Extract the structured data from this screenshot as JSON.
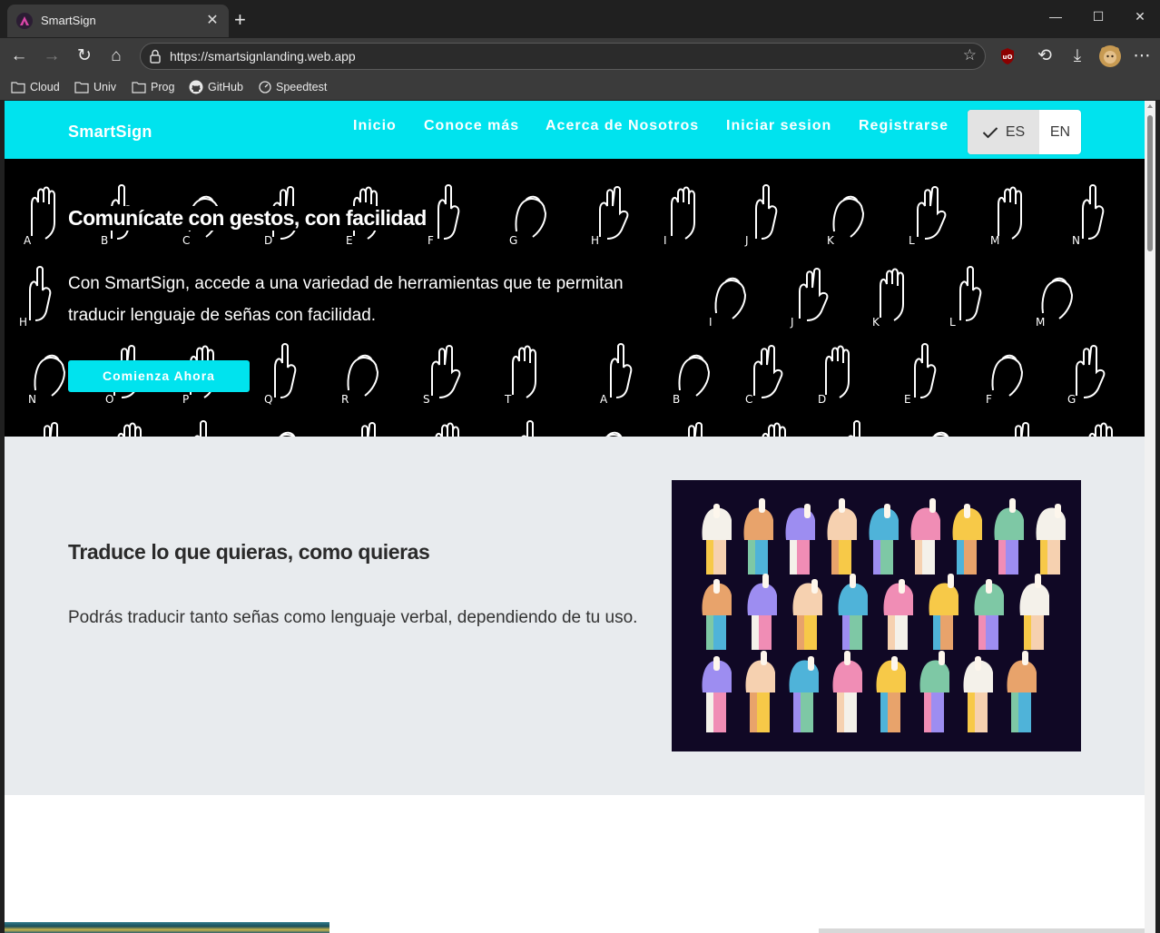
{
  "browser": {
    "tab_title": "SmartSign",
    "url": "https://smartsignlanding.web.app",
    "bookmarks": [
      "Cloud",
      "Univ",
      "Prog",
      "GitHub",
      "Speedtest"
    ]
  },
  "site": {
    "brand": "SmartSign",
    "nav": [
      "Inicio",
      "Conoce más",
      "Acerca de Nosotros",
      "Iniciar sesion",
      "Registrarse"
    ],
    "lang_selected": "ES",
    "lang_other": "EN",
    "accent_color": "#00e3ee"
  },
  "hero": {
    "title": "Comunícate con gestos, con facilidad",
    "text": "Con SmartSign, accede a una variedad de herramientas que te permitan traducir lenguaje de señas con facilidad.",
    "cta": "Comienza Ahora",
    "pattern_letters": [
      "A",
      "B",
      "C",
      "D",
      "E",
      "F",
      "G",
      "H",
      "I",
      "J",
      "K",
      "L",
      "M",
      "N",
      "O",
      "P",
      "Q",
      "R",
      "S",
      "T"
    ]
  },
  "feature": {
    "title": "Traduce lo que quieras, como quieras",
    "text": "Podrás traducir tanto señas como lenguaje verbal, dependiendo de tu uso."
  }
}
